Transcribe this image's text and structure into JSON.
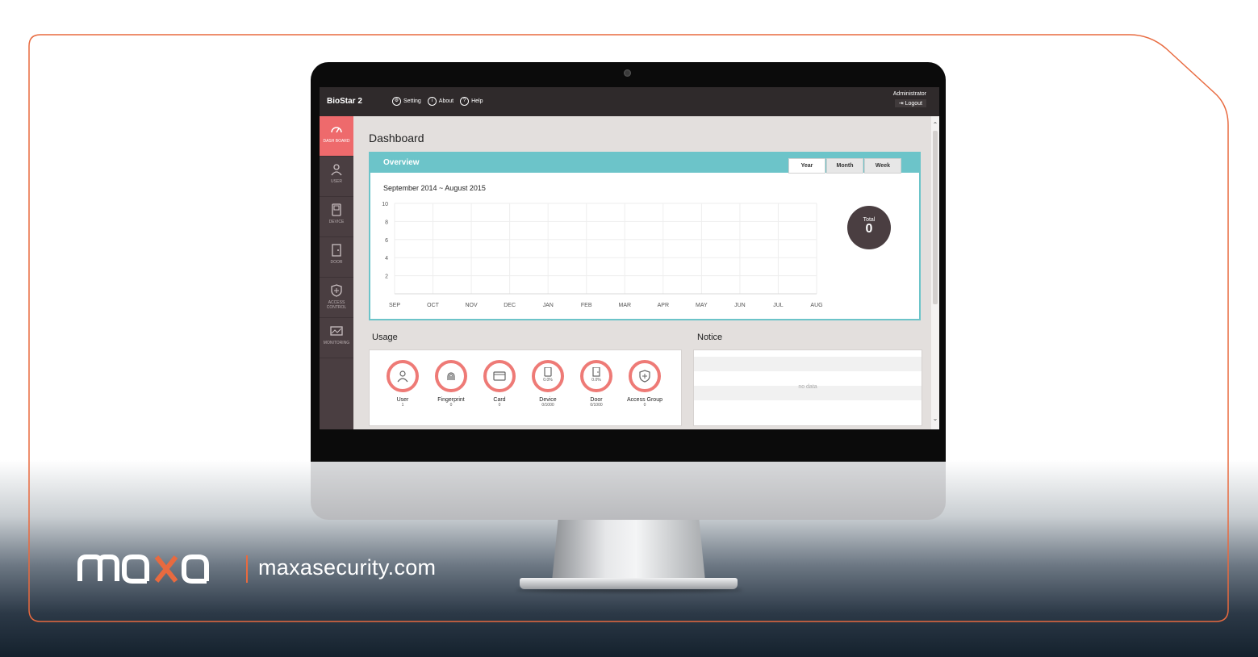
{
  "app": {
    "title": "BioStar 2"
  },
  "topnav": [
    {
      "label": "Setting",
      "icon": "gear-icon"
    },
    {
      "label": "About",
      "icon": "info-icon"
    },
    {
      "label": "Help",
      "icon": "help-icon"
    }
  ],
  "account": {
    "user": "Administrator",
    "logout": "Logout"
  },
  "sidebar": {
    "items": [
      {
        "label": "DASH BOARD",
        "icon": "dashboard-icon",
        "active": true
      },
      {
        "label": "USER",
        "icon": "user-icon"
      },
      {
        "label": "DEVICE",
        "icon": "device-icon"
      },
      {
        "label": "DOOR",
        "icon": "door-icon"
      },
      {
        "label": "ACCESS CONTROL",
        "icon": "access-control-icon"
      },
      {
        "label": "MONITORING",
        "icon": "monitoring-icon"
      }
    ]
  },
  "dashboard": {
    "title": "Dashboard",
    "overview": {
      "title": "Overview",
      "tabs": [
        "Year",
        "Month",
        "Week"
      ],
      "active_tab": "Year",
      "range": "September 2014 ~ August 2015",
      "total_label": "Total",
      "total_value": "0"
    },
    "usage": {
      "title": "Usage",
      "items": [
        {
          "label": "User",
          "value": "1",
          "icon": "user-icon"
        },
        {
          "label": "Fingerprint",
          "value": "0",
          "icon": "fingerprint-icon"
        },
        {
          "label": "Card",
          "value": "0",
          "icon": "card-icon"
        },
        {
          "label": "Device",
          "value": "0/1000",
          "percent": "0.0%",
          "icon": "device-icon"
        },
        {
          "label": "Door",
          "value": "0/1000",
          "percent": "0.0%",
          "icon": "door-icon"
        },
        {
          "label": "Access Group",
          "value": "0",
          "icon": "access-group-icon"
        }
      ]
    },
    "notice": {
      "title": "Notice",
      "empty": "no data"
    }
  },
  "chart_data": {
    "type": "line",
    "categories": [
      "SEP",
      "OCT",
      "NOV",
      "DEC",
      "JAN",
      "FEB",
      "MAR",
      "APR",
      "MAY",
      "JUN",
      "JUL",
      "AUG"
    ],
    "yticks": [
      2,
      4,
      6,
      8,
      10
    ],
    "ylim": [
      0,
      10
    ],
    "series": [],
    "grid": true
  },
  "branding": {
    "logo": "maxa",
    "site": "maxasecurity.com",
    "accent": "#e86a3f"
  }
}
